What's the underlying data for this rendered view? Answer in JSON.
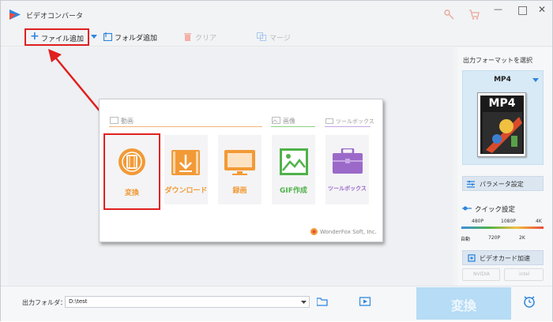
{
  "app": {
    "title": "ビデオコンバータ"
  },
  "toolbar": {
    "add_file": "ファイル追加",
    "add_folder": "フォルダ追加",
    "clear": "クリア",
    "merge": "マージ"
  },
  "window": {
    "minimize": "—",
    "maximize": "□",
    "close": "✕"
  },
  "menu": {
    "sections": {
      "video": "動画",
      "image": "画像",
      "toolbox": "ツールボックス"
    },
    "tiles": [
      "変換",
      "ダウンロード",
      "録画",
      "GIF作成",
      "ツールボックス"
    ],
    "footer": "WonderFox Soft, Inc."
  },
  "right_panel": {
    "title": "出力フォーマットを選択",
    "format": "MP4",
    "format_badge": "MP4",
    "params_button": "パラメータ設定",
    "quick_settings": "クイック設定",
    "quality_top": [
      "480P",
      "1080P",
      "4K"
    ],
    "quality_bottom": [
      "自動",
      "720P",
      "2K"
    ],
    "gpu_button": "ビデオカード加速",
    "gpu_vendors": [
      "NVIDIA",
      "intel"
    ]
  },
  "bottom": {
    "folder_label": "出力フォルダ：",
    "folder_value": "D:\\test",
    "convert_button": "変換"
  },
  "colors": {
    "accent_orange": "#f29a36",
    "highlight_red": "#e02020",
    "blue": "#3d8fe0",
    "green": "#4fb24a",
    "purple": "#9b6ac9"
  }
}
